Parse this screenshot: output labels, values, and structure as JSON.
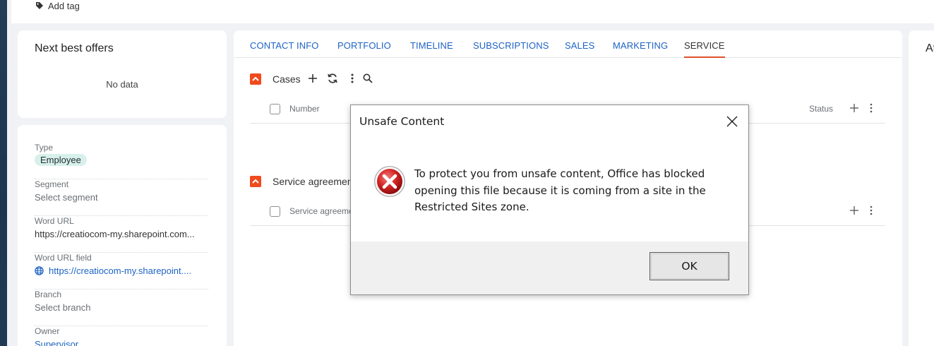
{
  "header": {
    "add_tag_label": "Add tag"
  },
  "offers": {
    "title": "Next best offers",
    "empty_text": "No data"
  },
  "fields": [
    {
      "label": "Type",
      "value": "Employee"
    },
    {
      "label": "Segment",
      "value": "Select segment"
    },
    {
      "label": "Word URL",
      "value": "https://creatiocom-my.sharepoint.com..."
    },
    {
      "label": "Word URL field",
      "value": "https://creatiocom-my.sharepoint...."
    },
    {
      "label": "Branch",
      "value": "Select branch"
    },
    {
      "label": "Owner",
      "value": "Supervisor"
    }
  ],
  "tabs": [
    {
      "label": "CONTACT INFO"
    },
    {
      "label": "PORTFOLIO"
    },
    {
      "label": "TIMELINE"
    },
    {
      "label": "SUBSCRIPTIONS"
    },
    {
      "label": "SALES"
    },
    {
      "label": "MARKETING"
    },
    {
      "label": "SERVICE",
      "active": true
    }
  ],
  "cases": {
    "title": "Cases",
    "col_number": "Number",
    "col_status": "Status"
  },
  "agreements": {
    "title": "Service agreements",
    "col_name": "Service agreement"
  },
  "right_panel": {
    "title_fragment": "At"
  },
  "dialog": {
    "title": "Unsafe Content",
    "message": "To protect you from unsafe content, Office has blocked opening this file because it is coming from a site in the Restricted Sites zone.",
    "ok_label": "OK"
  },
  "colors": {
    "accent": "#f04a1d",
    "link": "#1e63c4",
    "badge_bg": "#d8f0ec"
  }
}
